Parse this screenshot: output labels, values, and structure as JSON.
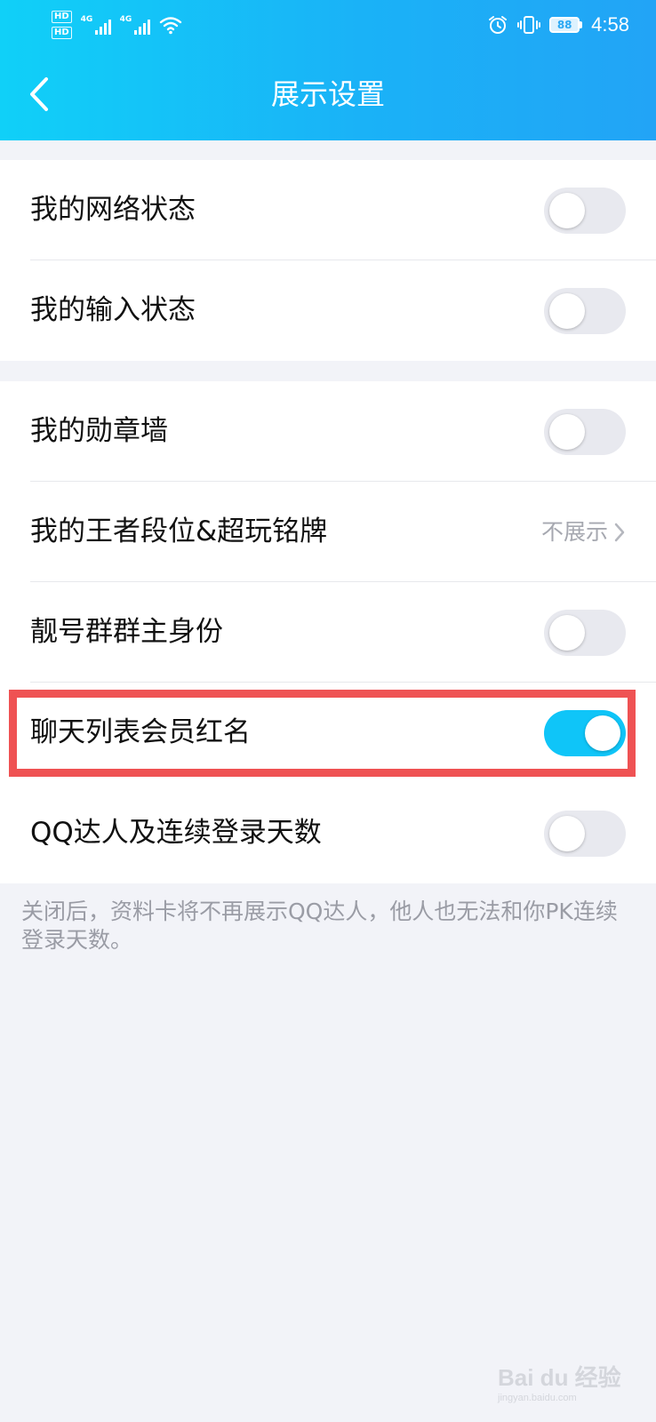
{
  "status_bar": {
    "hd1": "HD",
    "hd2": "HD",
    "net1": "4G",
    "net2": "4G",
    "battery": "88",
    "time": "4:58"
  },
  "header": {
    "title": "展示设置",
    "back_icon": "chevron-left-icon"
  },
  "settings": {
    "group1": [
      {
        "label": "我的网络状态",
        "toggle": false
      },
      {
        "label": "我的输入状态",
        "toggle": false
      }
    ],
    "group2": [
      {
        "label": "我的勋章墙",
        "toggle": false
      },
      {
        "label": "我的王者段位&超玩铭牌",
        "value": "不展示"
      },
      {
        "label": "靓号群群主身份",
        "toggle": false
      },
      {
        "label": "聊天列表会员红名",
        "toggle": true
      },
      {
        "label": "QQ达人及连续登录天数",
        "toggle": false
      }
    ]
  },
  "footnote": "关闭后，资料卡将不再展示QQ达人，他人也无法和你PK连续登录天数。",
  "watermark": {
    "brand": "Bai du 经验",
    "url": "jingyan.baidu.com"
  },
  "colors": {
    "header_start": "#10d0f8",
    "header_end": "#22a4f6",
    "toggle_on": "#0fc5f8",
    "toggle_off": "#e8e9ef",
    "highlight": "#ef5253",
    "background": "#f2f3f8"
  }
}
